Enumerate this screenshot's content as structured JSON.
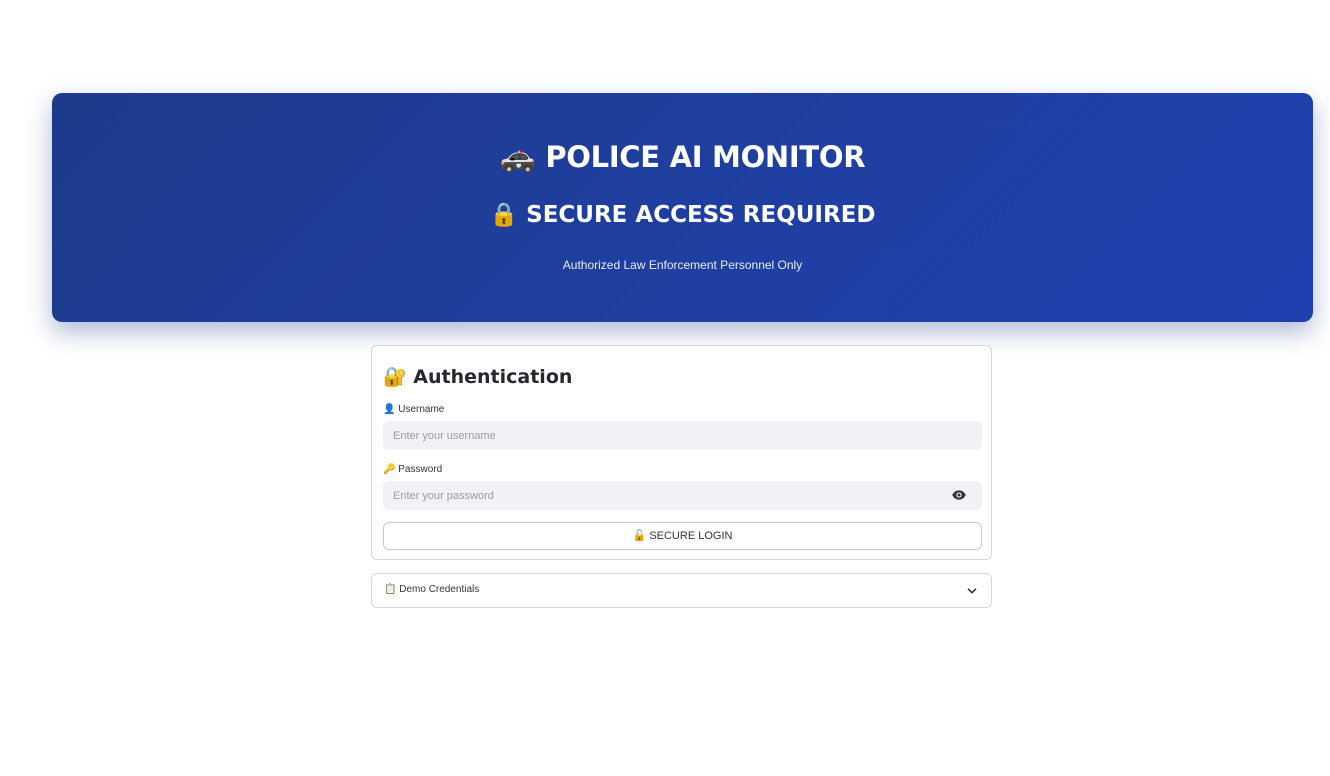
{
  "header": {
    "title_icon": "🚓",
    "title": "POLICE AI MONITOR",
    "subtitle_icon": "🔒",
    "subtitle": "SECURE ACCESS REQUIRED",
    "note": "Authorized Law Enforcement Personnel Only",
    "gradient_colors": [
      "#1e3a8a",
      "#1e40af"
    ]
  },
  "auth": {
    "title_icon": "🔐",
    "title": "Authentication",
    "username": {
      "icon": "👤",
      "label": "Username",
      "value": "",
      "placeholder": "Enter your username"
    },
    "password": {
      "icon": "🔑",
      "label": "Password",
      "value": "",
      "placeholder": "Enter your password",
      "toggle_icon": "eye-icon"
    },
    "login_icon": "🔓",
    "login_label": "SECURE LOGIN"
  },
  "expander": {
    "icon": "📋",
    "label": "Demo Credentials",
    "chevron_icon": "chevron-down-icon",
    "expanded": false
  }
}
